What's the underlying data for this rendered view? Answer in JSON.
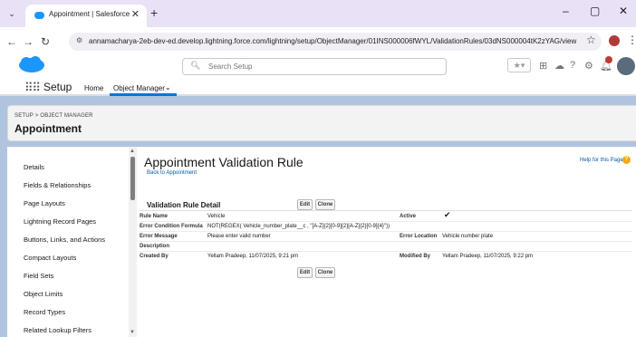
{
  "browser": {
    "tab_title": "Appointment | Salesforce",
    "tab_close": "✕",
    "new_tab": "+",
    "url": "annamacharya-2eb-dev-ed.develop.lightning.force.com/lightning/setup/ObjectManager/01INS000006fWYL/ValidationRules/03dNS000004tK2zYAG/view",
    "win_minimize": "–",
    "win_restore": "▢",
    "win_close": "✕"
  },
  "header": {
    "search_placeholder": "Search Setup",
    "favorites": "★▾"
  },
  "nav": {
    "app_name": "Setup",
    "items": [
      "Home",
      "Object Manager"
    ],
    "dropdown": "⌄"
  },
  "page_header": {
    "breadcrumb": "SETUP > OBJECT MANAGER",
    "title": "Appointment"
  },
  "sidebar": {
    "items": [
      "Details",
      "Fields & Relationships",
      "Page Layouts",
      "Lightning Record Pages",
      "Buttons, Links, and Actions",
      "Compact Layouts",
      "Field Sets",
      "Object Limits",
      "Record Types",
      "Related Lookup Filters"
    ]
  },
  "main": {
    "title": "Appointment Validation Rule",
    "back_link": "Back to Appointment",
    "help_link": "Help for this Page",
    "section_title": "Validation Rule Detail",
    "edit_label": "Edit",
    "clone_label": "Clone",
    "fields": {
      "rule_name_label": "Rule Name",
      "rule_name_value": "Vehicle",
      "active_label": "Active",
      "active_value": "✔",
      "formula_label": "Error Condition Formula",
      "formula_value": "NOT(REGEX( Vehicle_number_plate__c , \"[A-Z]{2}[0-9]{2}[A-Z]{2}[0-9]{4}\"))",
      "message_label": "Error Message",
      "message_value": "Please enter valid number",
      "location_label": "Error Location",
      "location_value": "Vehicle number plate",
      "description_label": "Description",
      "created_label": "Created By",
      "created_value": "Yellam Pradeep, 11/07/2025, 9:21 pm",
      "modified_label": "Modified By",
      "modified_value": "Yellam Pradeep, 11/07/2025, 9:22 pm"
    }
  },
  "colors": {
    "brand": "#1b96ff",
    "band": "#b0c4df",
    "link": "#015ba7",
    "active_tab": "#0176d3"
  }
}
